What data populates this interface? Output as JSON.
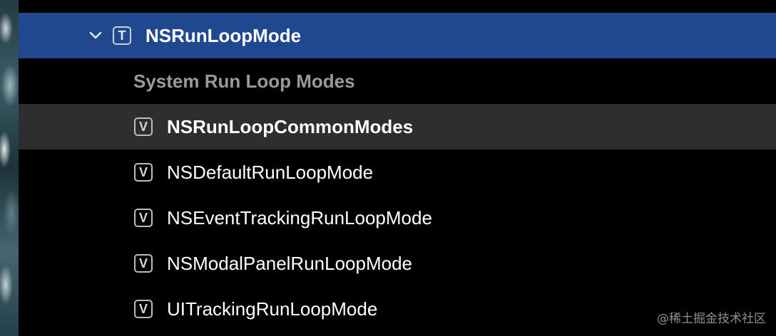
{
  "outline": {
    "selected_type": {
      "badge": "T",
      "label": "NSRunLoopMode",
      "expanded": true,
      "icon": "chevron-down-icon"
    },
    "section_header": "System Run Loop Modes",
    "items": [
      {
        "badge": "V",
        "label": "NSRunLoopCommonModes",
        "highlighted": true
      },
      {
        "badge": "V",
        "label": "NSDefaultRunLoopMode"
      },
      {
        "badge": "V",
        "label": "NSEventTrackingRunLoopMode"
      },
      {
        "badge": "V",
        "label": "NSModalPanelRunLoopMode"
      },
      {
        "badge": "V",
        "label": "UITrackingRunLoopMode"
      }
    ]
  },
  "watermark": "@稀土掘金技术社区",
  "colors": {
    "background": "#000000",
    "selection": "#20488f",
    "hover": "#2e2e2e",
    "section_text": "#9a9a9a",
    "text": "#ffffff"
  }
}
